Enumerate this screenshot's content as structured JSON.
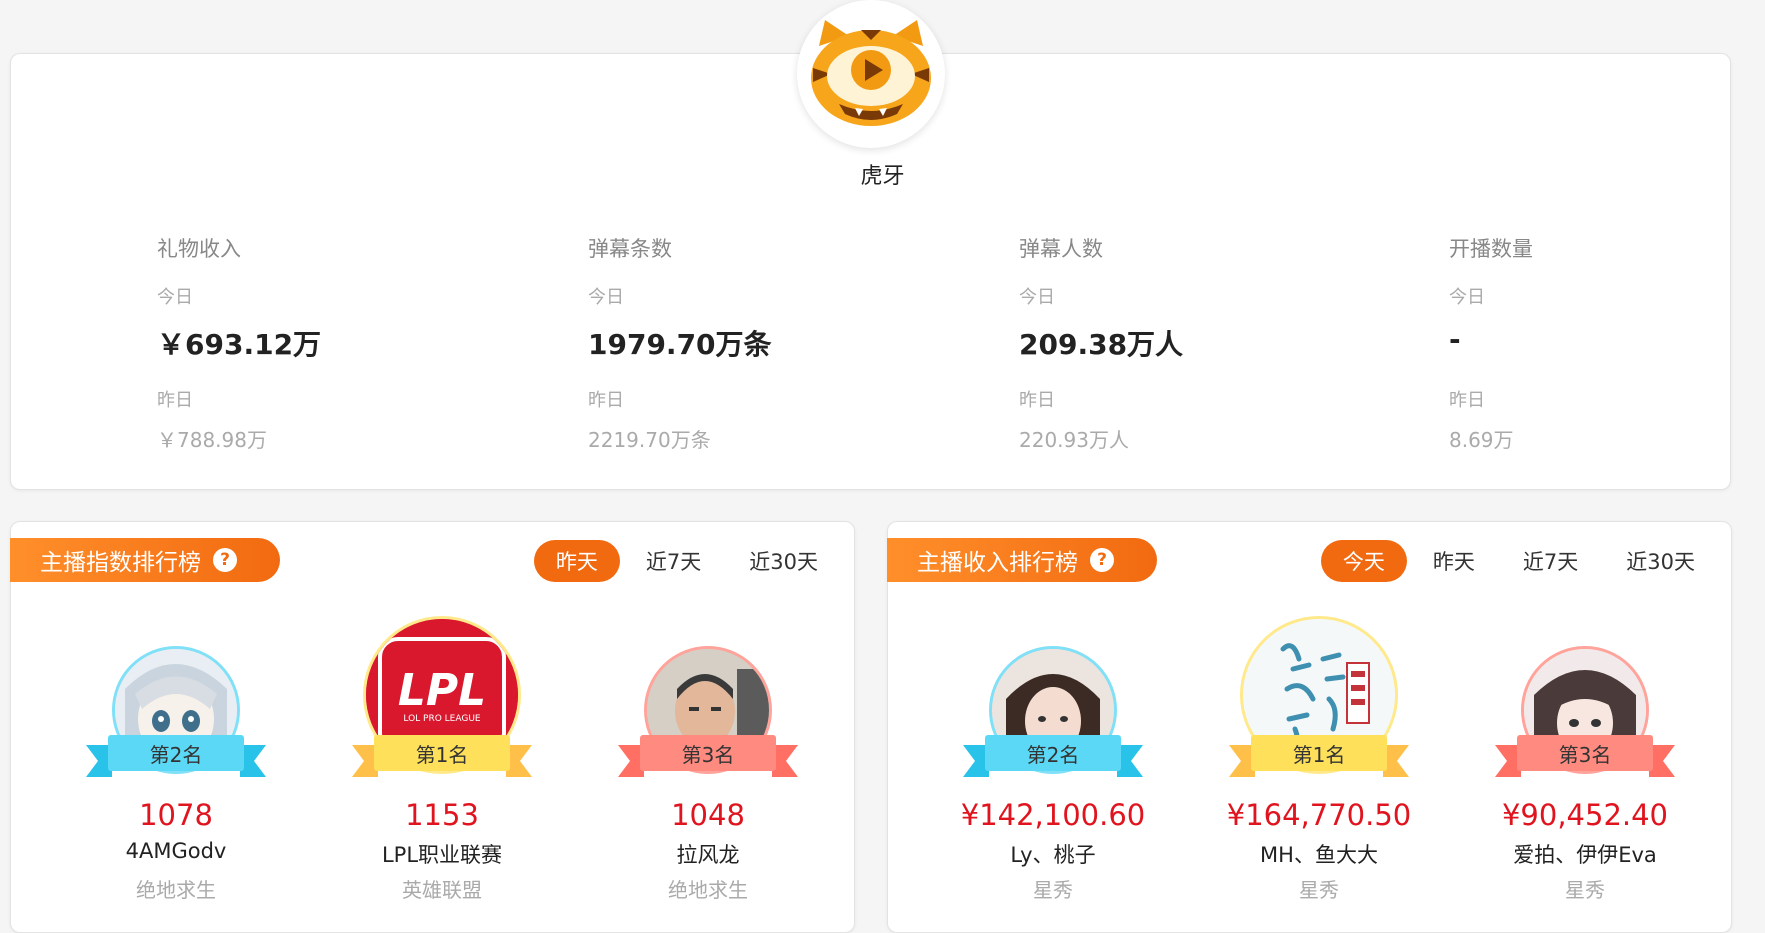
{
  "platform": {
    "name": "虎牙"
  },
  "stats": [
    {
      "label": "礼物收入",
      "today_label": "今日",
      "today_value": "￥693.12万",
      "yesterday_label": "昨日",
      "yesterday_value": "￥788.98万"
    },
    {
      "label": "弹幕条数",
      "today_label": "今日",
      "today_value": "1979.70万条",
      "yesterday_label": "昨日",
      "yesterday_value": "2219.70万条"
    },
    {
      "label": "弹幕人数",
      "today_label": "今日",
      "today_value": "209.38万人",
      "yesterday_label": "昨日",
      "yesterday_value": "220.93万人"
    },
    {
      "label": "开播数量",
      "today_label": "今日",
      "today_value": "-",
      "yesterday_label": "昨日",
      "yesterday_value": "8.69万"
    }
  ],
  "index_rank": {
    "title": "主播指数排行榜",
    "help": "?",
    "tabs": [
      "昨天",
      "近7天",
      "近30天"
    ],
    "active_tab": "昨天",
    "entries": [
      {
        "rank_label": "第2名",
        "value": "1078",
        "name": "4AMGodv",
        "category": "绝地求生"
      },
      {
        "rank_label": "第1名",
        "value": "1153",
        "name": "LPL职业联赛",
        "category": "英雄联盟"
      },
      {
        "rank_label": "第3名",
        "value": "1048",
        "name": "拉风龙",
        "category": "绝地求生"
      }
    ]
  },
  "income_rank": {
    "title": "主播收入排行榜",
    "help": "?",
    "tabs": [
      "今天",
      "昨天",
      "近7天",
      "近30天"
    ],
    "active_tab": "今天",
    "entries": [
      {
        "rank_label": "第2名",
        "value": "¥142,100.60",
        "name": "Ly、桃子",
        "category": "星秀"
      },
      {
        "rank_label": "第1名",
        "value": "¥164,770.50",
        "name": "MH、鱼大大",
        "category": "星秀"
      },
      {
        "rank_label": "第3名",
        "value": "¥90,452.40",
        "name": "爱拍、伊伊Eva",
        "category": "星秀"
      }
    ]
  },
  "lpl_logo": {
    "main": "LPL",
    "sub": "LOL PRO LEAGUE"
  },
  "colors": {
    "accent": "#f26a10",
    "rank1": "#ffe05a",
    "rank2": "#5ad8f5",
    "rank3": "#ff8a80",
    "value_red": "#e0141e"
  }
}
